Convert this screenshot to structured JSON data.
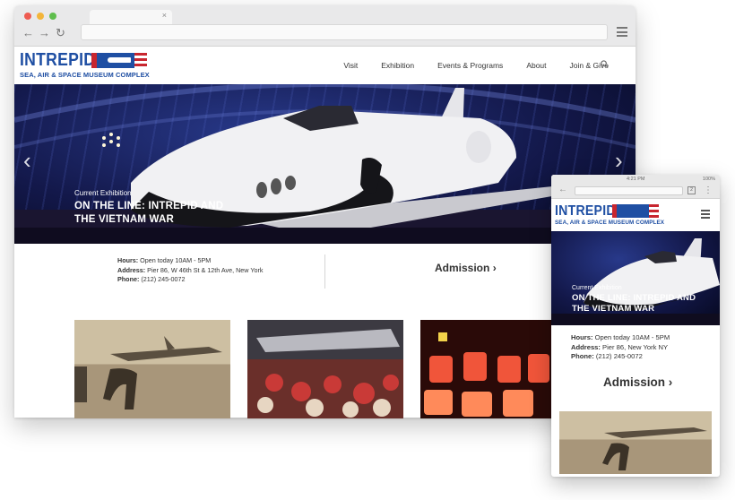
{
  "site": {
    "logo_word": "INTREPID",
    "logo_sub": "SEA, AIR & SPACE MUSEUM COMPLEX",
    "brand_blue": "#1f4fa3",
    "brand_red": "#c8262f"
  },
  "nav": [
    "Visit",
    "Exhibition",
    "Events & Programs",
    "About",
    "Join & Give"
  ],
  "hero": {
    "kicker": "Current Exhibition",
    "title": "ON THE LINE: INTREPID AND THE VIETNAM WAR",
    "prev_icon": "chevron-left-icon",
    "next_icon": "chevron-right-icon"
  },
  "info": {
    "hours_label": "Hours:",
    "hours_value": "Open today 10AM - 5PM",
    "address_label": "Address:",
    "address_value": "Pier 86, W 46th St & 12th Ave, New York",
    "phone_label": "Phone:",
    "phone_value": "(212) 245-0072",
    "admission": "Admission"
  },
  "mobile": {
    "status_time": "4:21 PM",
    "status_battery": "100%",
    "tab_count": "2",
    "address_value": "Pier 86, New York NY",
    "admission": "Admission"
  },
  "icons": {
    "browser_back": "arrow-left-icon",
    "browser_forward": "arrow-right-icon",
    "browser_reload": "reload-icon",
    "browser_menu": "hamburger-icon",
    "search": "search-icon"
  }
}
